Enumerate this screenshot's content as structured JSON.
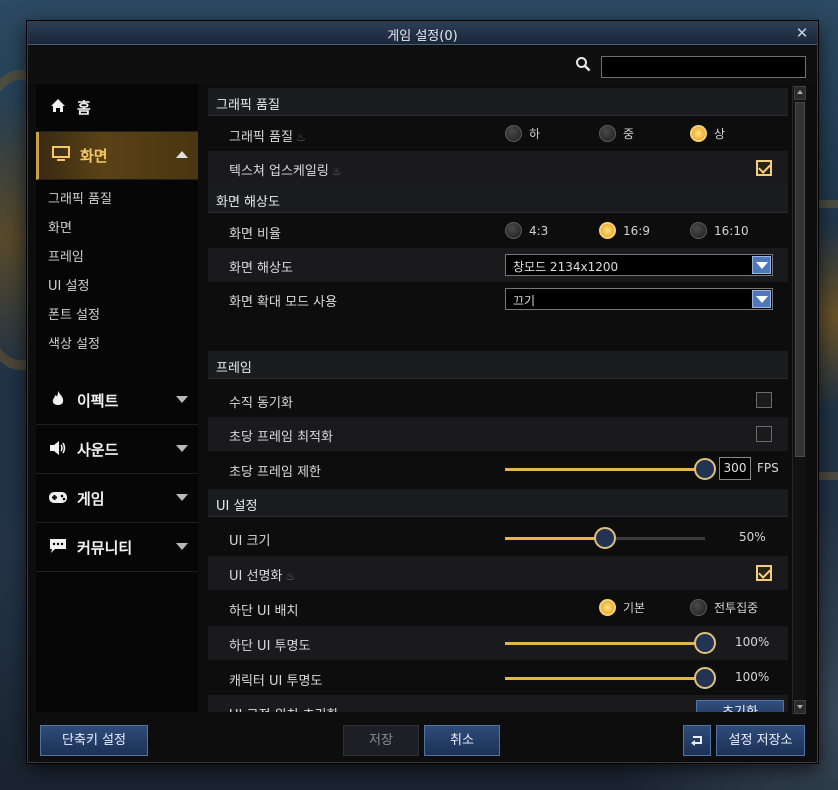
{
  "window": {
    "title": "게임 설정(0)"
  },
  "search": {
    "placeholder": "",
    "value": ""
  },
  "sidebar": {
    "home": "홈",
    "screen": "화면",
    "sub_items": [
      "그래픽 품질",
      "화면",
      "프레임",
      "UI 설정",
      "폰트 설정",
      "색상 설정"
    ],
    "effect": "이펙트",
    "sound": "사운드",
    "game": "게임",
    "community": "커뮤니티"
  },
  "sections": {
    "graphic_quality": "그래픽 품질",
    "resolution": "화면 해상도",
    "frame": "프레임",
    "ui": "UI 설정"
  },
  "settings": {
    "graphic_quality": {
      "label": "그래픽 품질",
      "options": [
        "하",
        "중",
        "상"
      ],
      "selected": "상"
    },
    "texture_upscaling": {
      "label": "텍스쳐 업스케일링",
      "checked": true
    },
    "aspect_ratio": {
      "label": "화면 비율",
      "options": [
        "4:3",
        "16:9",
        "16:10"
      ],
      "selected": "16:9"
    },
    "resolution": {
      "label": "화면 해상도",
      "value": "창모드 2134x1200"
    },
    "zoom_mode": {
      "label": "화면 확대 모드 사용",
      "value": "끄기"
    },
    "vsync": {
      "label": "수직 동기화",
      "checked": false
    },
    "fps_opt": {
      "label": "초당 프레임 최적화",
      "checked": false
    },
    "fps_limit": {
      "label": "초당 프레임 제한",
      "value": "300",
      "unit": "FPS",
      "fraction": 1.0
    },
    "ui_size": {
      "label": "UI 크기",
      "value": "50%",
      "fraction": 0.5
    },
    "ui_sharpen": {
      "label": "UI 선명화",
      "checked": true
    },
    "bottom_ui_layout": {
      "label": "하단 UI 배치",
      "options": [
        "기본",
        "전투집중"
      ],
      "selected": "기본"
    },
    "bottom_ui_opacity": {
      "label": "하단 UI 투명도",
      "value": "100%",
      "fraction": 1.0
    },
    "char_ui_opacity": {
      "label": "캐릭터 UI 투명도",
      "value": "100%",
      "fraction": 1.0
    },
    "ui_pos_reset": {
      "label": "UI 고정 위치 초기화",
      "button": "초기화"
    }
  },
  "footer": {
    "shortcut": "단축키 설정",
    "save": "저장",
    "cancel": "취소",
    "save_settings": "설정 저장소"
  },
  "colors": {
    "accent": "#f0b93c",
    "button": "#2e4c7b"
  }
}
